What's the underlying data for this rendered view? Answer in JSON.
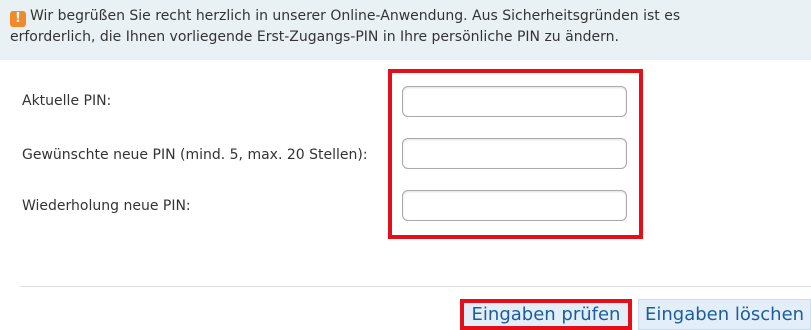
{
  "notice": {
    "icon": "exclamation-icon",
    "icon_glyph": "!",
    "icon_color": "#f08a2b",
    "line1": "Wir begrüßen Sie recht herzlich in unserer Online-Anwendung. Aus Sicherheitsgründen ist es",
    "line2": "erforderlich, die Ihnen vorliegende Erst-Zugangs-PIN in Ihre persönliche PIN zu ändern."
  },
  "form": {
    "current_pin_label": "Aktuelle PIN:",
    "current_pin_value": "",
    "new_pin_label": "Gewünschte neue PIN (mind. 5, max. 20 Stellen):",
    "new_pin_value": "",
    "repeat_pin_label": "Wiederholung neue PIN:",
    "repeat_pin_value": ""
  },
  "buttons": {
    "check_label": "Eingaben prüfen",
    "clear_label": "Eingaben löschen"
  },
  "colors": {
    "highlight": "#e3101a",
    "notice_background": "#eaf1f4",
    "button_text": "#1a5ea0",
    "button_background": "#e4eef8"
  }
}
